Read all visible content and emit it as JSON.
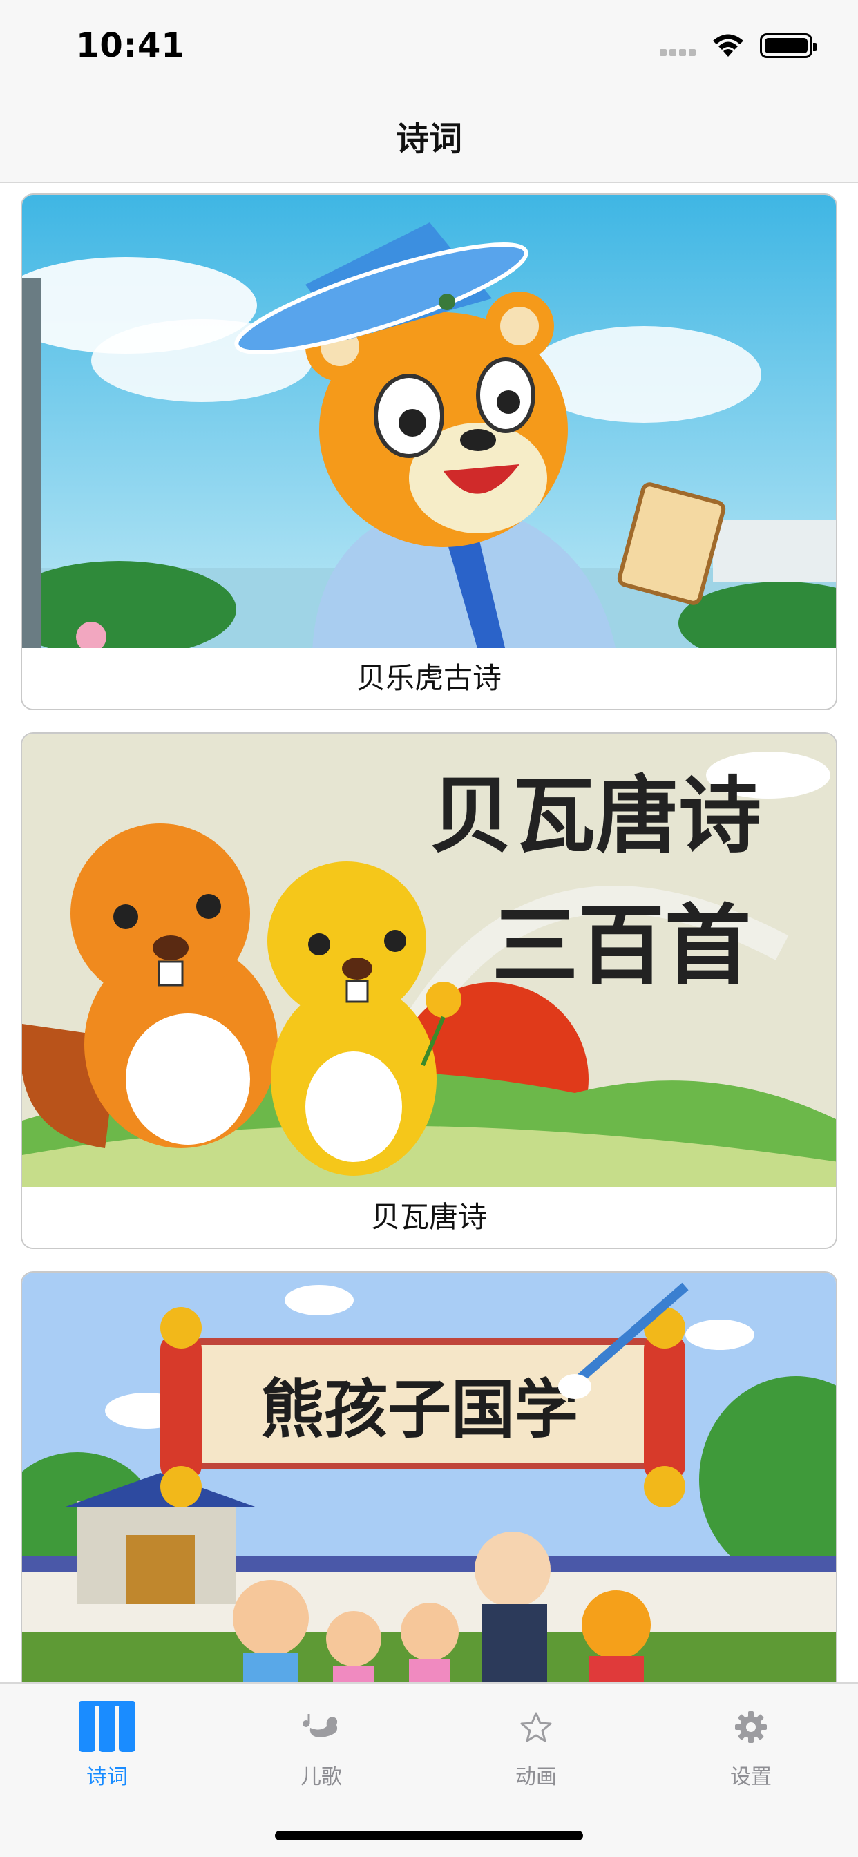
{
  "status_bar": {
    "time": "10:41"
  },
  "nav": {
    "title": "诗词"
  },
  "cards": [
    {
      "label": "贝乐虎古诗"
    },
    {
      "label": "贝瓦唐诗",
      "image_text": {
        "line1": "贝瓦唐诗",
        "line2": "三百首"
      }
    },
    {
      "label": "",
      "image_text": {
        "banner": "熊孩子国学"
      }
    }
  ],
  "tabs": [
    {
      "label": "诗词",
      "icon": "book-icon",
      "active": true
    },
    {
      "label": "儿歌",
      "icon": "music-duck-icon",
      "active": false
    },
    {
      "label": "动画",
      "icon": "star-icon",
      "active": false
    },
    {
      "label": "设置",
      "icon": "gear-icon",
      "active": false
    }
  ],
  "colors": {
    "accent": "#1a8cff",
    "inactive": "#8e8e93",
    "bar_bg": "#f7f7f7"
  }
}
